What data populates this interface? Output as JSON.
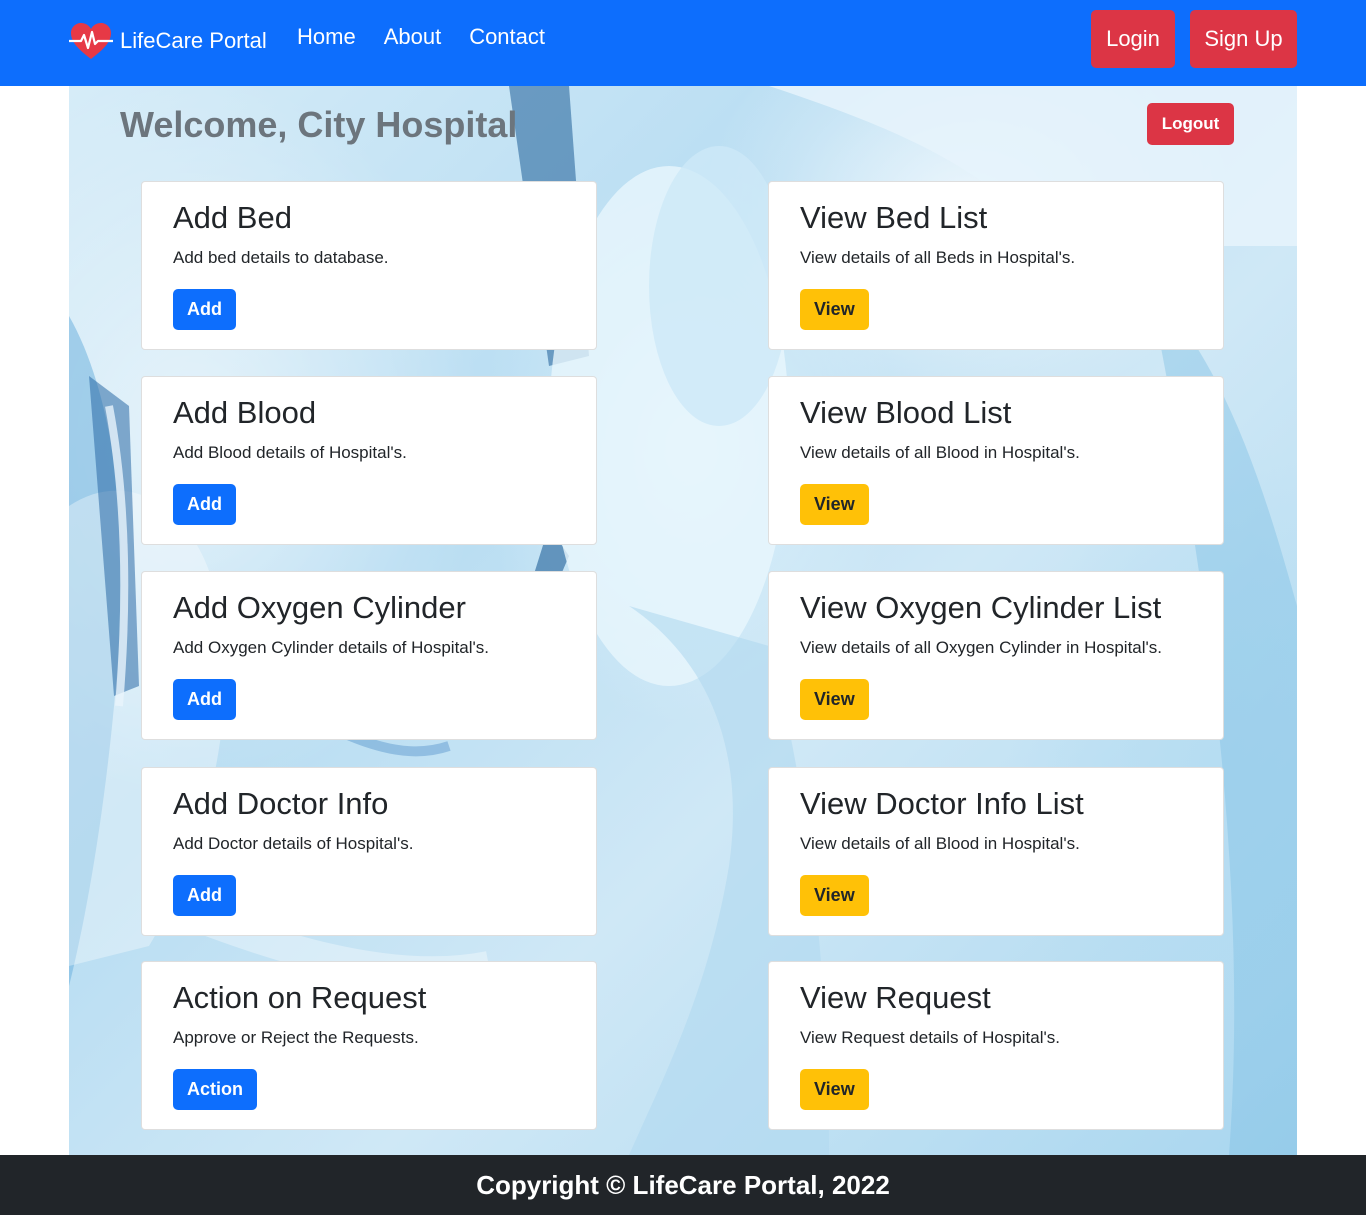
{
  "navbar": {
    "brand": "LifeCare Portal",
    "links": [
      {
        "label": "Home"
      },
      {
        "label": "About"
      },
      {
        "label": "Contact"
      }
    ],
    "login_label": "Login",
    "signup_label": "Sign Up",
    "brand_icon": "heart-pulse-icon",
    "color": "#0d6efd"
  },
  "dashboard": {
    "welcome": "Welcome, City Hospital",
    "logout_label": "Logout",
    "cards": [
      {
        "title": "Add Bed",
        "text": "Add bed details to database.",
        "button": "Add",
        "variant": "primary"
      },
      {
        "title": "View Bed List",
        "text": "View details of all Beds in Hospital's.",
        "button": "View",
        "variant": "warning"
      },
      {
        "title": "Add Blood",
        "text": "Add Blood details of Hospital's.",
        "button": "Add",
        "variant": "primary"
      },
      {
        "title": "View Blood List",
        "text": "View details of all Blood in Hospital's.",
        "button": "View",
        "variant": "warning"
      },
      {
        "title": "Add Oxygen Cylinder",
        "text": "Add Oxygen Cylinder details of Hospital's.",
        "button": "Add",
        "variant": "primary"
      },
      {
        "title": "View Oxygen Cylinder List",
        "text": "View details of all Oxygen Cylinder in Hospital's.",
        "button": "View",
        "variant": "warning"
      },
      {
        "title": "Add Doctor Info",
        "text": "Add Doctor details of Hospital's.",
        "button": "Add",
        "variant": "primary"
      },
      {
        "title": "View Doctor Info List",
        "text": "View details of all Blood in Hospital's.",
        "button": "View",
        "variant": "warning"
      },
      {
        "title": "Action on Request",
        "text": "Approve or Reject the Requests.",
        "button": "Action",
        "variant": "primary"
      },
      {
        "title": "View Request",
        "text": "View Request details of Hospital's.",
        "button": "View",
        "variant": "warning"
      }
    ]
  },
  "footer": {
    "copyright": "Copyright © LifeCare Portal, 2022"
  },
  "colors": {
    "primary": "#0d6efd",
    "warning": "#ffc107",
    "danger": "#dc3545",
    "footer": "#212529"
  }
}
